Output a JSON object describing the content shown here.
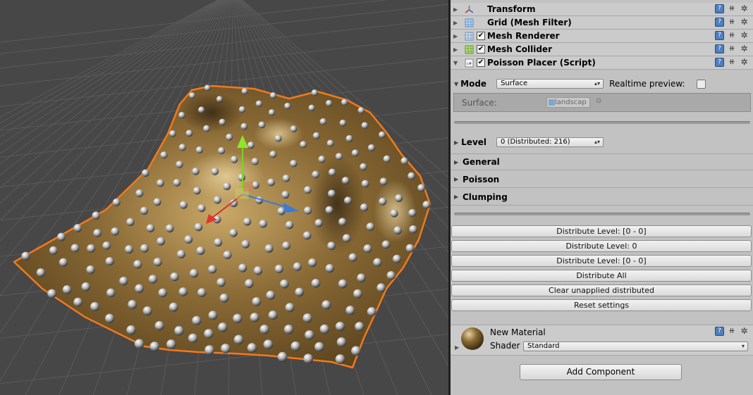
{
  "scene": {
    "accent_color": "#f07a1e",
    "terrain_color": "#8a6a35"
  },
  "components": [
    {
      "title": "Transform",
      "icon": "transform-icon",
      "checked": null
    },
    {
      "title": "Grid (Mesh Filter)",
      "icon": "mesh-filter-icon",
      "checked": null
    },
    {
      "title": "Mesh Renderer",
      "icon": "mesh-renderer-icon",
      "checked": true
    },
    {
      "title": "Mesh Collider",
      "icon": "mesh-collider-icon",
      "checked": true
    },
    {
      "title": "Poisson Placer (Script)",
      "icon": "script-icon",
      "checked": true
    }
  ],
  "poisson": {
    "mode_label": "Mode",
    "mode_value": "Surface",
    "realtime_label": "Realtime preview:",
    "surface_label": "Surface:",
    "surface_value": "landscap",
    "level_label": "Level",
    "level_value": "0 (Distributed: 216)",
    "foldouts": [
      "General",
      "Poisson",
      "Clumping"
    ]
  },
  "buttons": [
    "Distribute Level: [0 - 0]",
    "Distribute Level: 0",
    "Distribute Level: [0 - 0]",
    "Distribute All",
    "Clear unapplied distributed",
    "Reset settings"
  ],
  "material": {
    "name": "New Material",
    "shader_label": "Shader",
    "shader_value": "Standard"
  },
  "add_component_label": "Add Component"
}
